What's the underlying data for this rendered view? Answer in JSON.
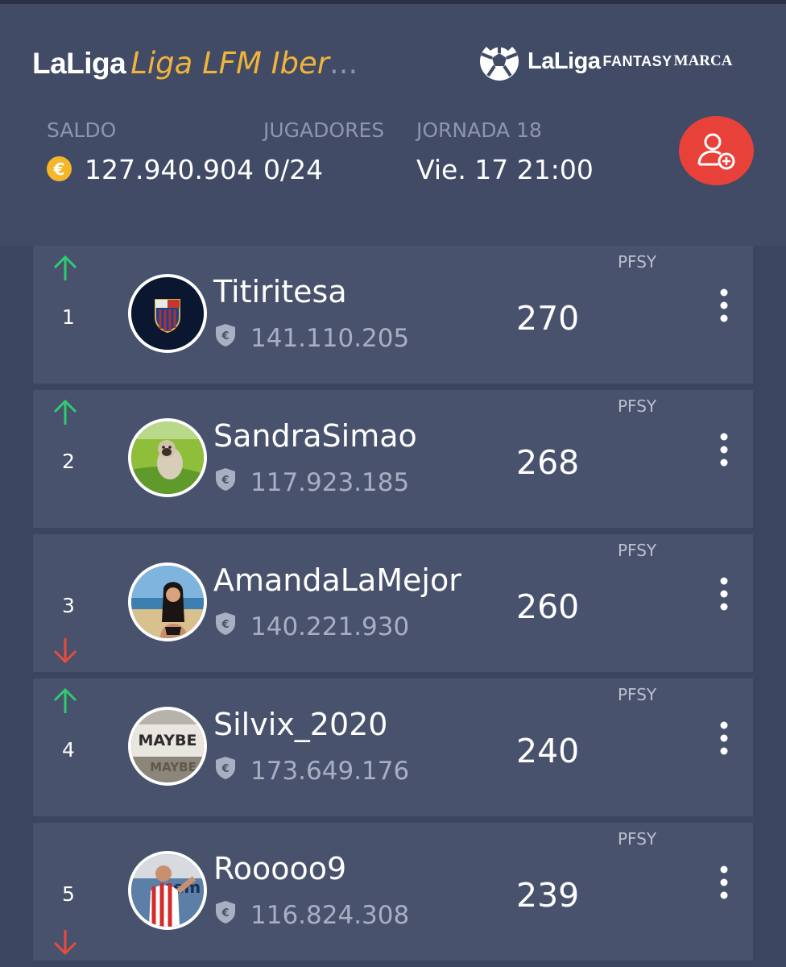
{
  "header": {
    "brand": "LaLiga",
    "league_name": "Liga LFM Iber",
    "ellipsis": "...",
    "logo": {
      "laliga": "LaLiga",
      "fantasy": "FANTASY",
      "marca": "MARCA"
    },
    "stats": [
      {
        "label": "SALDO",
        "value": "127.940.904"
      },
      {
        "label": "JUGADORES",
        "value": "0/24"
      },
      {
        "label": "JORNADA 18",
        "value": "Vie. 17 21:00"
      }
    ],
    "coin_symbol": "€"
  },
  "colors": {
    "accent": "#f0b43a",
    "add_button": "#e8413a",
    "up_arrow": "#2ecc71",
    "down_arrow": "#e74c3c"
  },
  "ranking": [
    {
      "rank": "1",
      "username": "Titiritesa",
      "value": "141.110.205",
      "points": "270",
      "tag": "PFSY",
      "trend": "up",
      "avatar": "fc-barcelona-crest"
    },
    {
      "rank": "2",
      "username": "SandraSimao",
      "value": "117.923.185",
      "points": "268",
      "tag": "PFSY",
      "trend": "up",
      "avatar": "dog-on-grass"
    },
    {
      "rank": "3",
      "username": "AmandaLaMejor",
      "value": "140.221.930",
      "points": "260",
      "tag": "PFSY",
      "trend": "down",
      "avatar": "woman-at-beach"
    },
    {
      "rank": "4",
      "username": "Silvix_2020",
      "value": "173.649.176",
      "points": "240",
      "tag": "PFSY",
      "trend": "up",
      "avatar": "maybe-sign"
    },
    {
      "rank": "5",
      "username": "Rooooo9",
      "value": "116.824.308",
      "points": "239",
      "tag": "PFSY",
      "trend": "down",
      "avatar": "footballer-red-white"
    }
  ]
}
